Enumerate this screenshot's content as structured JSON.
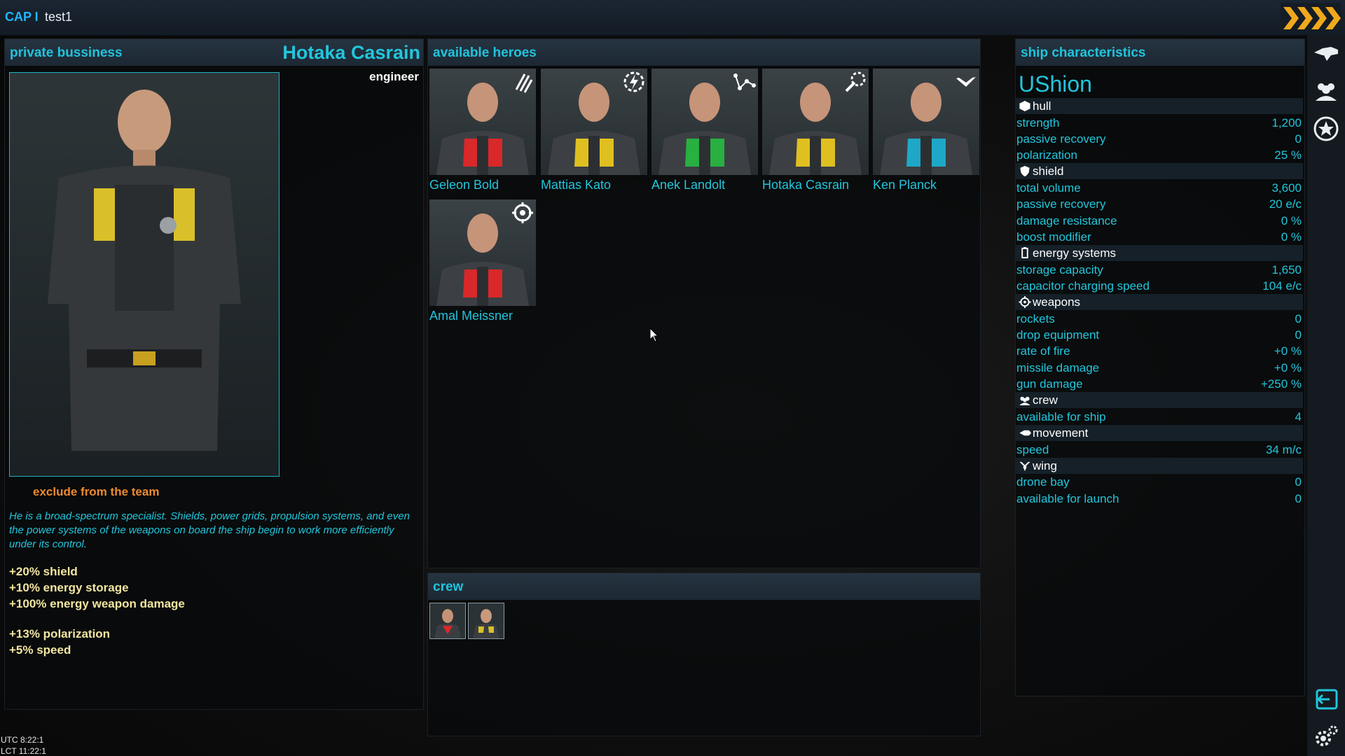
{
  "topbar": {
    "cap_label": "CAP I",
    "user": "test1"
  },
  "left_panel": {
    "title": "private bussiness",
    "hero_name": "Hotaka Casrain",
    "role": "engineer",
    "exclude_label": "exclude from the team",
    "description": "He is a broad-spectrum specialist. Shields, power grids, propulsion systems, and even the power systems of the weapons on board the ship begin to work more efficiently under its control.",
    "bonuses": [
      "+20% shield",
      "+10% energy storage",
      "+100% energy weapon damage",
      "+13% polarization",
      "+5% speed"
    ]
  },
  "heroes_panel": {
    "title": "available heroes",
    "heroes": [
      {
        "name": "Geleon Bold",
        "icon": "claw-slash-icon",
        "accent": "#d8282a"
      },
      {
        "name": "Mattias Kato",
        "icon": "lightning-gear-icon",
        "accent": "#e0c020"
      },
      {
        "name": "Anek Landolt",
        "icon": "node-graph-icon",
        "accent": "#28b040"
      },
      {
        "name": "Hotaka Casrain",
        "icon": "wrench-gear-icon",
        "accent": "#e0c020"
      },
      {
        "name": "Ken Planck",
        "icon": "wing-chevron-icon",
        "accent": "#1ea8c8"
      },
      {
        "name": "Amal Meissner",
        "icon": "crosshair-icon",
        "accent": "#d8282a"
      }
    ]
  },
  "crew_panel": {
    "title": "crew",
    "members": [
      "Amal Meissner",
      "Hotaka Casrain"
    ]
  },
  "ship_panel": {
    "title": "ship characteristics",
    "ship_name": "UShion",
    "sections": [
      {
        "name": "hull",
        "icon": "cube-icon",
        "stats": [
          [
            "strength",
            "1,200"
          ],
          [
            "passive recovery",
            "0"
          ],
          [
            "polarization",
            "25 %"
          ]
        ]
      },
      {
        "name": "shield",
        "icon": "shield-icon",
        "stats": [
          [
            "total volume",
            "3,600"
          ],
          [
            "passive recovery",
            "20 e/c"
          ],
          [
            "damage resistance",
            "0 %"
          ],
          [
            "boost modifier",
            "0 %"
          ]
        ]
      },
      {
        "name": "energy systems",
        "icon": "battery-icon",
        "stats": [
          [
            "storage capacity",
            "1,650"
          ],
          [
            "capacitor charging speed",
            "104 e/c"
          ]
        ]
      },
      {
        "name": "weapons",
        "icon": "crosshair-icon",
        "stats": [
          [
            "rockets",
            "0"
          ],
          [
            "drop equipment",
            "0"
          ],
          [
            "rate of fire",
            "+0 %"
          ],
          [
            "missile damage",
            "+0 %"
          ],
          [
            "gun damage",
            "+250 %"
          ]
        ]
      },
      {
        "name": "crew",
        "icon": "crew-icon",
        "stats": [
          [
            "available for ship",
            "4"
          ]
        ]
      },
      {
        "name": "movement",
        "icon": "thruster-icon",
        "stats": [
          [
            "speed",
            "34 m/c"
          ]
        ]
      },
      {
        "name": "wing",
        "icon": "drone-icon",
        "stats": [
          [
            "drone bay",
            "0"
          ],
          [
            "available for launch",
            "0"
          ]
        ]
      }
    ]
  },
  "sidebar": {
    "icons": [
      "ship-icon",
      "crew-group-icon",
      "star-badge-icon",
      "exit-icon",
      "settings-icon"
    ]
  },
  "clock": {
    "utc": "UTC 8:22:1",
    "lct": "LCT 11:22:1"
  },
  "colors": {
    "accent": "#22c6dc",
    "warning": "#ef8a2c",
    "bonus": "#f3e6a0"
  }
}
